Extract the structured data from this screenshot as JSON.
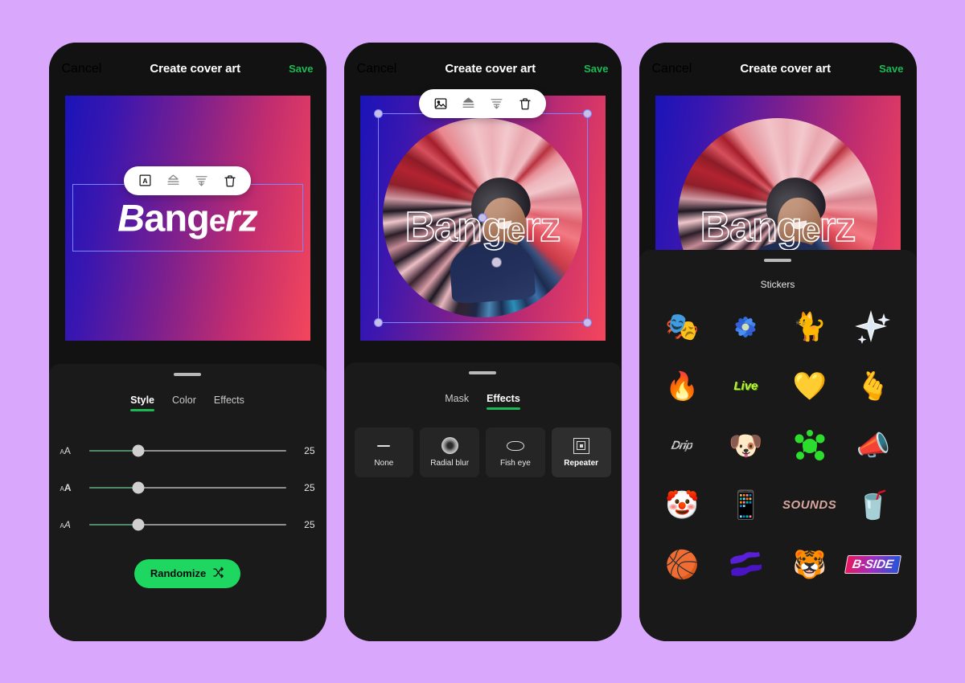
{
  "background_color": "#d9a8fd",
  "accent_green": "#1db954",
  "header": {
    "cancel": "Cancel",
    "title": "Create cover art",
    "save": "Save"
  },
  "artwork": {
    "title_text": "Bangerz",
    "title_parts": [
      {
        "text": "B",
        "style": "italic-bold-large"
      },
      {
        "text": "an",
        "style": "upright-bold-large"
      },
      {
        "text": "g",
        "style": "upright-bold-large"
      },
      {
        "text": "e",
        "style": "upright-bold-small"
      },
      {
        "text": "rz",
        "style": "italic-bold-large"
      }
    ],
    "gradient_from": "#1a14b8",
    "gradient_to": "#f4465c"
  },
  "text_toolbar": {
    "items": [
      {
        "icon": "text-box-icon",
        "name": "text-tool"
      },
      {
        "icon": "layers-icon",
        "name": "layer-tool"
      },
      {
        "icon": "align-icon",
        "name": "align-tool"
      },
      {
        "icon": "trash-icon",
        "name": "delete-tool"
      }
    ]
  },
  "image_toolbar": {
    "items": [
      {
        "icon": "image-icon",
        "name": "image-tool"
      },
      {
        "icon": "layers-icon",
        "name": "layer-tool"
      },
      {
        "icon": "align-icon",
        "name": "align-tool"
      },
      {
        "icon": "trash-icon",
        "name": "delete-tool"
      }
    ]
  },
  "panel_style": {
    "tabs": [
      {
        "label": "Style",
        "active": true
      },
      {
        "label": "Color",
        "active": false
      },
      {
        "label": "Effects",
        "active": false
      }
    ],
    "sliders": [
      {
        "icon": "font-size-icon",
        "icon_small": "A",
        "icon_large": "A",
        "value": "25",
        "percent": 25
      },
      {
        "icon": "font-weight-icon",
        "icon_small": "A",
        "icon_large": "A",
        "value": "25",
        "percent": 25
      },
      {
        "icon": "font-slant-icon",
        "icon_small": "A",
        "icon_large": "A",
        "value": "25",
        "percent": 25
      }
    ],
    "randomize_label": "Randomize",
    "randomize_icon": "shuffle-icon"
  },
  "panel_effects": {
    "tabs": [
      {
        "label": "Mask",
        "active": false
      },
      {
        "label": "Effects",
        "active": true
      }
    ],
    "options": [
      {
        "label": "None",
        "icon": "dash-icon",
        "selected": false
      },
      {
        "label": "Radial blur",
        "icon": "radial-blur-icon",
        "selected": false
      },
      {
        "label": "Fish eye",
        "icon": "fish-eye-icon",
        "selected": false
      },
      {
        "label": "Repeater",
        "icon": "repeater-icon",
        "selected": true
      }
    ]
  },
  "panel_stickers": {
    "title": "Stickers",
    "items": [
      {
        "name": "masked-character-sticker",
        "glyph": "🎭",
        "kind": "emoji"
      },
      {
        "name": "blue-flower-sticker",
        "glyph": "💫",
        "kind": "custom-flower"
      },
      {
        "name": "pink-cat-sticker",
        "glyph": "🐈",
        "kind": "emoji"
      },
      {
        "name": "sparkles-sticker",
        "glyph": "✦",
        "kind": "custom-sparkle"
      },
      {
        "name": "fire-sticker",
        "glyph": "🔥",
        "kind": "emoji"
      },
      {
        "name": "live-text-sticker",
        "glyph": "Live",
        "kind": "text-live"
      },
      {
        "name": "gold-heart-sticker",
        "glyph": "💛",
        "kind": "emoji"
      },
      {
        "name": "hand-fingers-sticker",
        "glyph": "🫰",
        "kind": "emoji"
      },
      {
        "name": "chrome-text-sticker",
        "glyph": "Drip",
        "kind": "text-chrome"
      },
      {
        "name": "bulldog-bone-sticker",
        "glyph": "🐶",
        "kind": "emoji"
      },
      {
        "name": "green-splat-sticker",
        "glyph": "✹",
        "kind": "custom-splat"
      },
      {
        "name": "megaphone-sticker",
        "glyph": "📣",
        "kind": "emoji"
      },
      {
        "name": "jester-sticker",
        "glyph": "🤡",
        "kind": "emoji"
      },
      {
        "name": "flip-phone-sticker",
        "glyph": "📱",
        "kind": "emoji"
      },
      {
        "name": "sounds-text-sticker",
        "glyph": "SOUNDS",
        "kind": "text-sounds"
      },
      {
        "name": "soda-can-sticker",
        "glyph": "🥤",
        "kind": "emoji"
      },
      {
        "name": "basketball-face-sticker",
        "glyph": "🏀",
        "kind": "emoji"
      },
      {
        "name": "purple-splatter-sticker",
        "glyph": "〰",
        "kind": "custom-squiggle"
      },
      {
        "name": "tiger-flames-sticker",
        "glyph": "🐯",
        "kind": "emoji"
      },
      {
        "name": "b-side-logo-sticker",
        "glyph": "B-SIDE",
        "kind": "text-bside"
      }
    ]
  }
}
